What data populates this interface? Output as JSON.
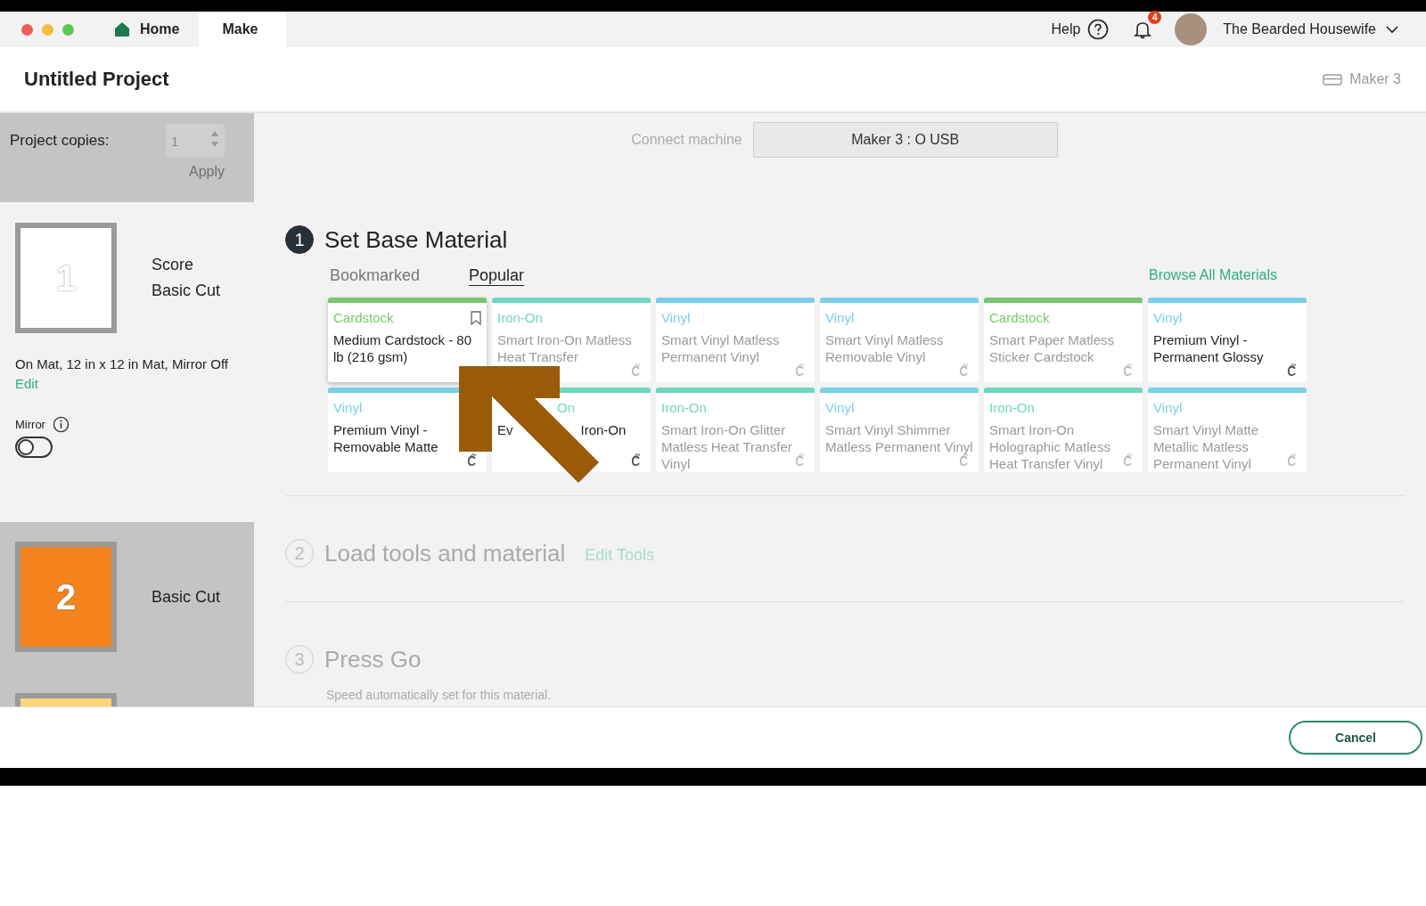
{
  "window": {
    "tabs": [
      {
        "label": "Home",
        "selected": false
      },
      {
        "label": "Make",
        "selected": true
      }
    ],
    "help": "Help",
    "notification_count": "4",
    "user": "The Bearded Housewife"
  },
  "header": {
    "title": "Untitled Project",
    "machine": "Maker 3"
  },
  "sidebar": {
    "copies_label": "Project copies:",
    "copies_value": "1",
    "apply": "Apply",
    "disabled": true,
    "mats": [
      {
        "number": "1",
        "color": "#ffffff",
        "selected": true,
        "operations": [
          "Score",
          "Basic Cut"
        ],
        "details": "On Mat, 12 in x 12 in Mat, Mirror Off",
        "edit": "Edit",
        "mirror_label": "Mirror",
        "mirror_on": false
      },
      {
        "number": "2",
        "color": "#f5841f",
        "selected": false,
        "operations": [
          "Basic Cut"
        ]
      },
      {
        "color": "#fcd77a",
        "selected": false
      }
    ]
  },
  "connect": {
    "label": "Connect machine",
    "value": "Maker 3 : O USB"
  },
  "steps": [
    {
      "number": "1",
      "title": "Set Base Material",
      "active": true
    },
    {
      "number": "2",
      "title": "Load tools and material",
      "active": false,
      "link": "Edit Tools"
    },
    {
      "number": "3",
      "title": "Press Go",
      "active": false,
      "note": "Speed automatically set for this material."
    }
  ],
  "materials": {
    "tabs": [
      {
        "label": "Bookmarked",
        "selected": false
      },
      {
        "label": "Popular",
        "selected": true
      }
    ],
    "browse": "Browse All Materials",
    "cards": [
      {
        "category": "Cardstock",
        "color": "#7ac66e",
        "name": "Medium Cardstock - 80 lb (216 gsm)",
        "dim": false,
        "selected": true
      },
      {
        "category": "Iron-On",
        "color": "#6fd6c0",
        "name": "Smart Iron-On Matless Heat Transfer",
        "dim": true,
        "selected": false
      },
      {
        "category": "Vinyl",
        "color": "#79cfe8",
        "name": "Smart Vinyl Matless Permanent Vinyl",
        "dim": true,
        "selected": false
      },
      {
        "category": "Vinyl",
        "color": "#79cfe8",
        "name": "Smart Vinyl Matless Removable Vinyl",
        "dim": true,
        "selected": false
      },
      {
        "category": "Cardstock",
        "color": "#7ac66e",
        "name": "Smart Paper Matless Sticker Cardstock",
        "dim": true,
        "selected": false
      },
      {
        "category": "Vinyl",
        "color": "#79cfe8",
        "name": "Premium Vinyl - Permanent Glossy",
        "dim": false,
        "selected": false
      },
      {
        "category": "Vinyl",
        "color": "#79cfe8",
        "name": "Premium Vinyl - Removable Matte",
        "dim": false,
        "selected": false
      },
      {
        "category": "On",
        "color": "#6fd6c0",
        "name": "Ev",
        "name_tail": "Iron-On",
        "dim": false,
        "selected": false,
        "covered": true
      },
      {
        "category": "Iron-On",
        "color": "#6fd6c0",
        "name": "Smart Iron-On Glitter Matless Heat Transfer Vinyl",
        "dim": true,
        "selected": false
      },
      {
        "category": "Vinyl",
        "color": "#79cfe8",
        "name": "Smart Vinyl Shimmer Matless Permanent Vinyl",
        "dim": true,
        "selected": false
      },
      {
        "category": "Iron-On",
        "color": "#6fd6c0",
        "name": "Smart Iron-On Holographic Matless Heat Transfer Vinyl",
        "dim": true,
        "selected": false
      },
      {
        "category": "Vinyl",
        "color": "#79cfe8",
        "name": "Smart Vinyl Matte Metallic Matless Permanent Vinyl",
        "dim": true,
        "selected": false
      }
    ]
  },
  "footer": {
    "cancel": "Cancel"
  }
}
